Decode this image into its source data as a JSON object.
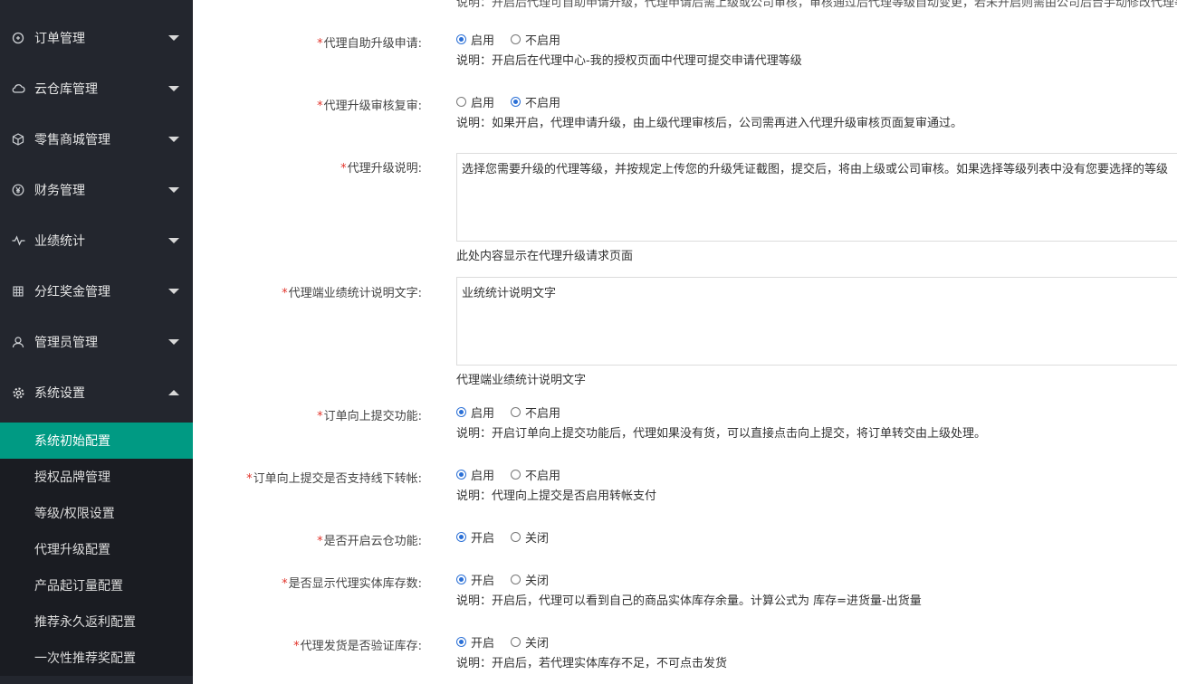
{
  "sidebar": {
    "menus": [
      {
        "label": "订单管理",
        "icon": "orders-icon"
      },
      {
        "label": "云仓库管理",
        "icon": "cloud-warehouse-icon"
      },
      {
        "label": "零售商城管理",
        "icon": "package-icon"
      },
      {
        "label": "财务管理",
        "icon": "yen-icon"
      },
      {
        "label": "业绩统计",
        "icon": "pulse-icon"
      },
      {
        "label": "分红奖金管理",
        "icon": "grid-icon"
      },
      {
        "label": "管理员管理",
        "icon": "user-icon"
      },
      {
        "label": "系统设置",
        "icon": "gear-icon"
      }
    ],
    "submenu": [
      {
        "label": "系统初始配置",
        "active": true
      },
      {
        "label": "授权品牌管理"
      },
      {
        "label": "等级/权限设置"
      },
      {
        "label": "代理升级配置"
      },
      {
        "label": "产品起订量配置"
      },
      {
        "label": "推荐永久返利配置"
      },
      {
        "label": "一次性推荐奖配置"
      }
    ]
  },
  "form": {
    "top_cut_text": "说明：开启后代理可自助申请升级，代理申请后需上级或公司审核，审核通过后代理等级自动变更，若未开启则需由公司后台手动修改代理等级。",
    "required_mark": "*",
    "fields": [
      {
        "label": "代理自助升级申请:",
        "options": [
          "启用",
          "不启用"
        ],
        "selected": 0,
        "desc": "说明：开启后在代理中心-我的授权页面中代理可提交申请代理等级"
      },
      {
        "label": "代理升级审核复审:",
        "options": [
          "启用",
          "不启用"
        ],
        "selected": 1,
        "desc": "说明：如果开启，代理申请升级，由上级代理审核后，公司需再进入代理升级审核页面复审通过。"
      },
      {
        "label": "代理升级说明:",
        "textarea": "选择您需要升级的代理等级，并按规定上传您的升级凭证截图，提交后，将由上级或公司审核。如果选择等级列表中没有您要选择的等级",
        "desc": "此处内容显示在代理升级请求页面"
      },
      {
        "label": "代理端业绩统计说明文字:",
        "textarea": "业统统计说明文字",
        "desc": "代理端业绩统计说明文字"
      },
      {
        "label": "订单向上提交功能:",
        "options": [
          "启用",
          "不启用"
        ],
        "selected": 0,
        "desc": "说明：开启订单向上提交功能后，代理如果没有货，可以直接点击向上提交，将订单转交由上级处理。"
      },
      {
        "label": "订单向上提交是否支持线下转帐:",
        "options": [
          "启用",
          "不启用"
        ],
        "selected": 0,
        "desc": "说明：代理向上提交是否启用转帐支付"
      },
      {
        "label": "是否开启云仓功能:",
        "options": [
          "开启",
          "关闭"
        ],
        "selected": 0,
        "desc": ""
      },
      {
        "label": "是否显示代理实体库存数:",
        "options": [
          "开启",
          "关闭"
        ],
        "selected": 0,
        "desc": "说明：开启后，代理可以看到自己的商品实体库存余量。计算公式为 库存=进货量-出货量"
      },
      {
        "label": "代理发货是否验证库存:",
        "options": [
          "开启",
          "关闭"
        ],
        "selected": 0,
        "desc": "说明：开启后，若代理实体库存不足，不可点击发货"
      }
    ]
  }
}
